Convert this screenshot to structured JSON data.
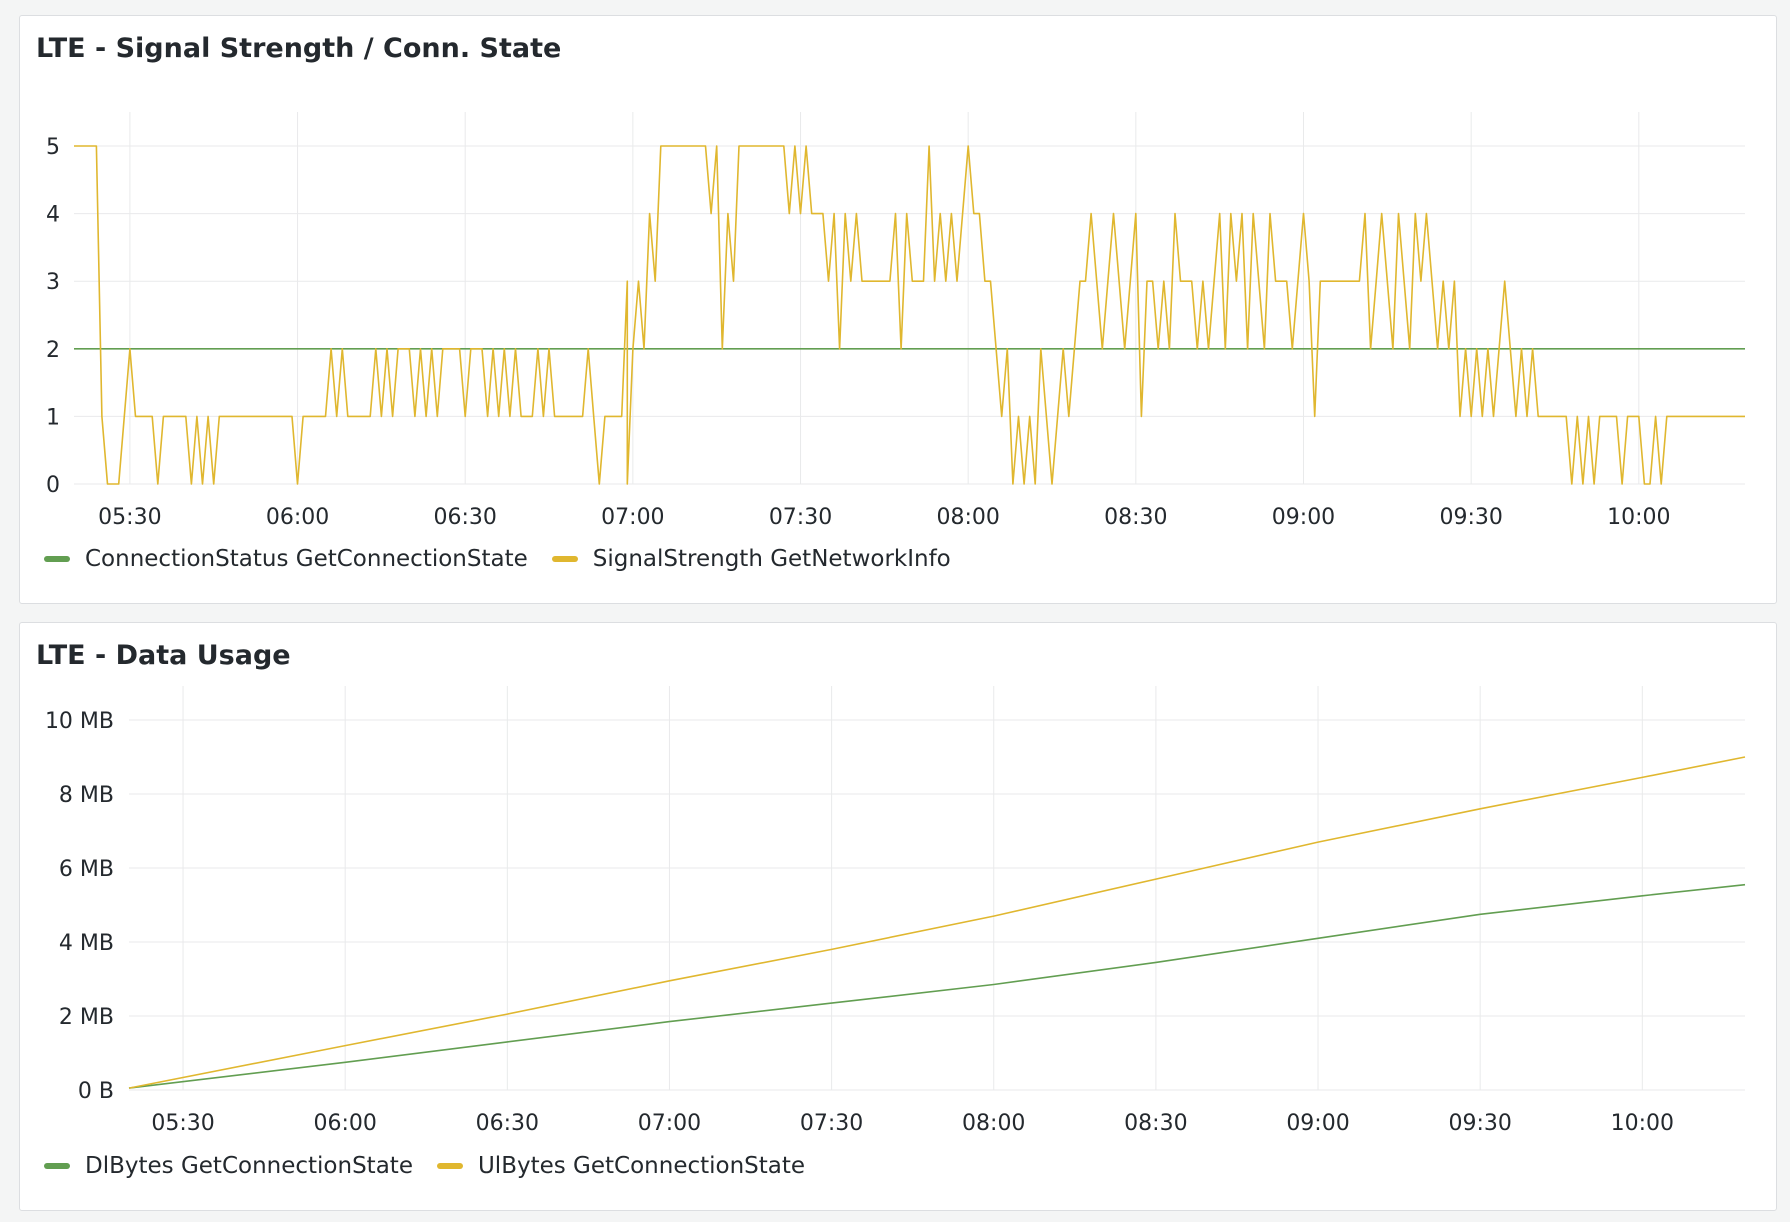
{
  "chart_data": [
    {
      "type": "line",
      "title": "LTE - Signal Strength / Conn. State",
      "x_ticks": [
        "05:30",
        "06:00",
        "06:30",
        "07:00",
        "07:30",
        "08:00",
        "08:30",
        "09:00",
        "09:30",
        "10:00"
      ],
      "x_range": [
        "05:20",
        "10:19"
      ],
      "y_ticks": [
        "0",
        "1",
        "2",
        "3",
        "4",
        "5"
      ],
      "ylim": [
        0,
        5
      ],
      "grid": true,
      "legend_position": "bottom-left",
      "colors": {
        "ConnectionStatus": "#629e51",
        "SignalStrength": "#e0b72f"
      },
      "series": [
        {
          "name": "ConnectionStatus GetConnectionState",
          "color": "#629e51",
          "points": [
            [
              "05:20",
              2
            ],
            [
              "10:19",
              2
            ]
          ]
        },
        {
          "name": "SignalStrength GetNetworkInfo",
          "color": "#e0b72f",
          "points": [
            [
              "05:20",
              5
            ],
            [
              "05:24",
              5
            ],
            [
              "05:25",
              1
            ],
            [
              "05:26",
              0
            ],
            [
              "05:28",
              0
            ],
            [
              "05:29",
              1
            ],
            [
              "05:30",
              2
            ],
            [
              "05:31",
              1
            ],
            [
              "05:34",
              1
            ],
            [
              "05:35",
              0
            ],
            [
              "05:36",
              1
            ],
            [
              "05:40",
              1
            ],
            [
              "05:41",
              0
            ],
            [
              "05:42",
              1
            ],
            [
              "05:43",
              0
            ],
            [
              "05:44",
              1
            ],
            [
              "05:45",
              0
            ],
            [
              "05:46",
              1
            ],
            [
              "05:59",
              1
            ],
            [
              "06:00",
              0
            ],
            [
              "06:01",
              1
            ],
            [
              "06:05",
              1
            ],
            [
              "06:06",
              2
            ],
            [
              "06:07",
              1
            ],
            [
              "06:08",
              2
            ],
            [
              "06:09",
              1
            ],
            [
              "06:13",
              1
            ],
            [
              "06:14",
              2
            ],
            [
              "06:15",
              1
            ],
            [
              "06:16",
              2
            ],
            [
              "06:17",
              1
            ],
            [
              "06:18",
              2
            ],
            [
              "06:20",
              2
            ],
            [
              "06:21",
              1
            ],
            [
              "06:22",
              2
            ],
            [
              "06:23",
              1
            ],
            [
              "06:24",
              2
            ],
            [
              "06:25",
              1
            ],
            [
              "06:26",
              2
            ],
            [
              "06:29",
              2
            ],
            [
              "06:30",
              1
            ],
            [
              "06:31",
              2
            ],
            [
              "06:33",
              2
            ],
            [
              "06:34",
              1
            ],
            [
              "06:35",
              2
            ],
            [
              "06:36",
              1
            ],
            [
              "06:37",
              2
            ],
            [
              "06:38",
              1
            ],
            [
              "06:39",
              2
            ],
            [
              "06:40",
              1
            ],
            [
              "06:42",
              1
            ],
            [
              "06:43",
              2
            ],
            [
              "06:44",
              1
            ],
            [
              "06:45",
              2
            ],
            [
              "06:46",
              1
            ],
            [
              "06:51",
              1
            ],
            [
              "06:52",
              2
            ],
            [
              "06:53",
              1
            ],
            [
              "06:54",
              0
            ],
            [
              "06:55",
              1
            ],
            [
              "06:58",
              1
            ],
            [
              "06:59",
              3
            ],
            [
              "06:59",
              0
            ],
            [
              "07:00",
              2
            ],
            [
              "07:01",
              3
            ],
            [
              "07:02",
              2
            ],
            [
              "07:03",
              4
            ],
            [
              "07:04",
              3
            ],
            [
              "07:05",
              5
            ],
            [
              "07:13",
              5
            ],
            [
              "07:14",
              4
            ],
            [
              "07:15",
              5
            ],
            [
              "07:16",
              2
            ],
            [
              "07:17",
              4
            ],
            [
              "07:18",
              3
            ],
            [
              "07:19",
              5
            ],
            [
              "07:27",
              5
            ],
            [
              "07:28",
              4
            ],
            [
              "07:29",
              5
            ],
            [
              "07:30",
              4
            ],
            [
              "07:31",
              5
            ],
            [
              "07:32",
              4
            ],
            [
              "07:34",
              4
            ],
            [
              "07:35",
              3
            ],
            [
              "07:36",
              4
            ],
            [
              "07:37",
              2
            ],
            [
              "07:38",
              4
            ],
            [
              "07:39",
              3
            ],
            [
              "07:40",
              4
            ],
            [
              "07:41",
              3
            ],
            [
              "07:46",
              3
            ],
            [
              "07:47",
              4
            ],
            [
              "07:48",
              2
            ],
            [
              "07:49",
              4
            ],
            [
              "07:50",
              3
            ],
            [
              "07:52",
              3
            ],
            [
              "07:53",
              5
            ],
            [
              "07:54",
              3
            ],
            [
              "07:55",
              4
            ],
            [
              "07:56",
              3
            ],
            [
              "07:57",
              4
            ],
            [
              "07:58",
              3
            ],
            [
              "07:59",
              4
            ],
            [
              "08:00",
              5
            ],
            [
              "08:01",
              4
            ],
            [
              "08:02",
              4
            ],
            [
              "08:03",
              3
            ],
            [
              "08:04",
              3
            ],
            [
              "08:05",
              2
            ],
            [
              "08:06",
              1
            ],
            [
              "08:07",
              2
            ],
            [
              "08:08",
              0
            ],
            [
              "08:09",
              1
            ],
            [
              "08:10",
              0
            ],
            [
              "08:11",
              1
            ],
            [
              "08:12",
              0
            ],
            [
              "08:13",
              2
            ],
            [
              "08:14",
              1
            ],
            [
              "08:15",
              0
            ],
            [
              "08:16",
              1
            ],
            [
              "08:17",
              2
            ],
            [
              "08:18",
              1
            ],
            [
              "08:19",
              2
            ],
            [
              "08:20",
              3
            ],
            [
              "08:21",
              3
            ],
            [
              "08:22",
              4
            ],
            [
              "08:23",
              3
            ],
            [
              "08:24",
              2
            ],
            [
              "08:25",
              3
            ],
            [
              "08:26",
              4
            ],
            [
              "08:27",
              3
            ],
            [
              "08:28",
              2
            ],
            [
              "08:29",
              3
            ],
            [
              "08:30",
              4
            ],
            [
              "08:31",
              1
            ],
            [
              "08:32",
              3
            ],
            [
              "08:33",
              3
            ],
            [
              "08:34",
              2
            ],
            [
              "08:35",
              3
            ],
            [
              "08:36",
              2
            ],
            [
              "08:37",
              4
            ],
            [
              "08:38",
              3
            ],
            [
              "08:40",
              3
            ],
            [
              "08:41",
              2
            ],
            [
              "08:42",
              3
            ],
            [
              "08:43",
              2
            ],
            [
              "08:44",
              3
            ],
            [
              "08:45",
              4
            ],
            [
              "08:46",
              2
            ],
            [
              "08:47",
              4
            ],
            [
              "08:48",
              3
            ],
            [
              "08:49",
              4
            ],
            [
              "08:50",
              2
            ],
            [
              "08:51",
              4
            ],
            [
              "08:52",
              3
            ],
            [
              "08:53",
              2
            ],
            [
              "08:54",
              4
            ],
            [
              "08:55",
              3
            ],
            [
              "08:57",
              3
            ],
            [
              "08:58",
              2
            ],
            [
              "08:59",
              3
            ],
            [
              "09:00",
              4
            ],
            [
              "09:01",
              3
            ],
            [
              "09:02",
              1
            ],
            [
              "09:03",
              3
            ],
            [
              "09:10",
              3
            ],
            [
              "09:11",
              4
            ],
            [
              "09:12",
              2
            ],
            [
              "09:13",
              3
            ],
            [
              "09:14",
              4
            ],
            [
              "09:15",
              3
            ],
            [
              "09:16",
              2
            ],
            [
              "09:17",
              4
            ],
            [
              "09:18",
              3
            ],
            [
              "09:19",
              2
            ],
            [
              "09:20",
              4
            ],
            [
              "09:21",
              3
            ],
            [
              "09:22",
              4
            ],
            [
              "09:23",
              3
            ],
            [
              "09:24",
              2
            ],
            [
              "09:25",
              3
            ],
            [
              "09:26",
              2
            ],
            [
              "09:27",
              3
            ],
            [
              "09:28",
              1
            ],
            [
              "09:29",
              2
            ],
            [
              "09:30",
              1
            ],
            [
              "09:31",
              2
            ],
            [
              "09:32",
              1
            ],
            [
              "09:33",
              2
            ],
            [
              "09:34",
              1
            ],
            [
              "09:35",
              2
            ],
            [
              "09:36",
              3
            ],
            [
              "09:37",
              2
            ],
            [
              "09:38",
              1
            ],
            [
              "09:39",
              2
            ],
            [
              "09:40",
              1
            ],
            [
              "09:41",
              2
            ],
            [
              "09:42",
              1
            ],
            [
              "09:43",
              1
            ],
            [
              "09:44",
              1
            ],
            [
              "09:47",
              1
            ],
            [
              "09:48",
              0
            ],
            [
              "09:49",
              1
            ],
            [
              "09:50",
              0
            ],
            [
              "09:51",
              1
            ],
            [
              "09:52",
              0
            ],
            [
              "09:53",
              1
            ],
            [
              "09:54",
              1
            ],
            [
              "09:56",
              1
            ],
            [
              "09:57",
              0
            ],
            [
              "09:58",
              1
            ],
            [
              "10:00",
              1
            ],
            [
              "10:01",
              0
            ],
            [
              "10:02",
              0
            ],
            [
              "10:03",
              1
            ],
            [
              "10:04",
              0
            ],
            [
              "10:05",
              1
            ],
            [
              "10:19",
              1
            ]
          ]
        }
      ]
    },
    {
      "type": "line",
      "title": "LTE - Data Usage",
      "x_ticks": [
        "05:30",
        "06:00",
        "06:30",
        "07:00",
        "07:30",
        "08:00",
        "08:30",
        "09:00",
        "09:30",
        "10:00"
      ],
      "x_range": [
        "05:20",
        "10:19"
      ],
      "y_ticks": [
        "0 B",
        "2 MB",
        "4 MB",
        "6 MB",
        "8 MB",
        "10 MB"
      ],
      "y_unit": "MB",
      "ylim": [
        0,
        10
      ],
      "grid": true,
      "legend_position": "bottom-left",
      "series": [
        {
          "name": "DlBytes GetConnectionState",
          "color": "#629e51",
          "points": [
            [
              "05:20",
              0.05
            ],
            [
              "06:00",
              0.75
            ],
            [
              "06:30",
              1.3
            ],
            [
              "07:00",
              1.85
            ],
            [
              "07:30",
              2.35
            ],
            [
              "08:00",
              2.85
            ],
            [
              "08:30",
              3.45
            ],
            [
              "09:00",
              4.1
            ],
            [
              "09:30",
              4.75
            ],
            [
              "10:00",
              5.25
            ],
            [
              "10:19",
              5.55
            ]
          ]
        },
        {
          "name": "UlBytes GetConnectionState",
          "color": "#e0b72f",
          "points": [
            [
              "05:20",
              0.05
            ],
            [
              "06:00",
              1.2
            ],
            [
              "06:30",
              2.05
            ],
            [
              "07:00",
              2.95
            ],
            [
              "07:30",
              3.8
            ],
            [
              "08:00",
              4.7
            ],
            [
              "08:30",
              5.7
            ],
            [
              "09:00",
              6.7
            ],
            [
              "09:30",
              7.6
            ],
            [
              "10:00",
              8.45
            ],
            [
              "10:19",
              9.0
            ]
          ]
        }
      ]
    }
  ]
}
